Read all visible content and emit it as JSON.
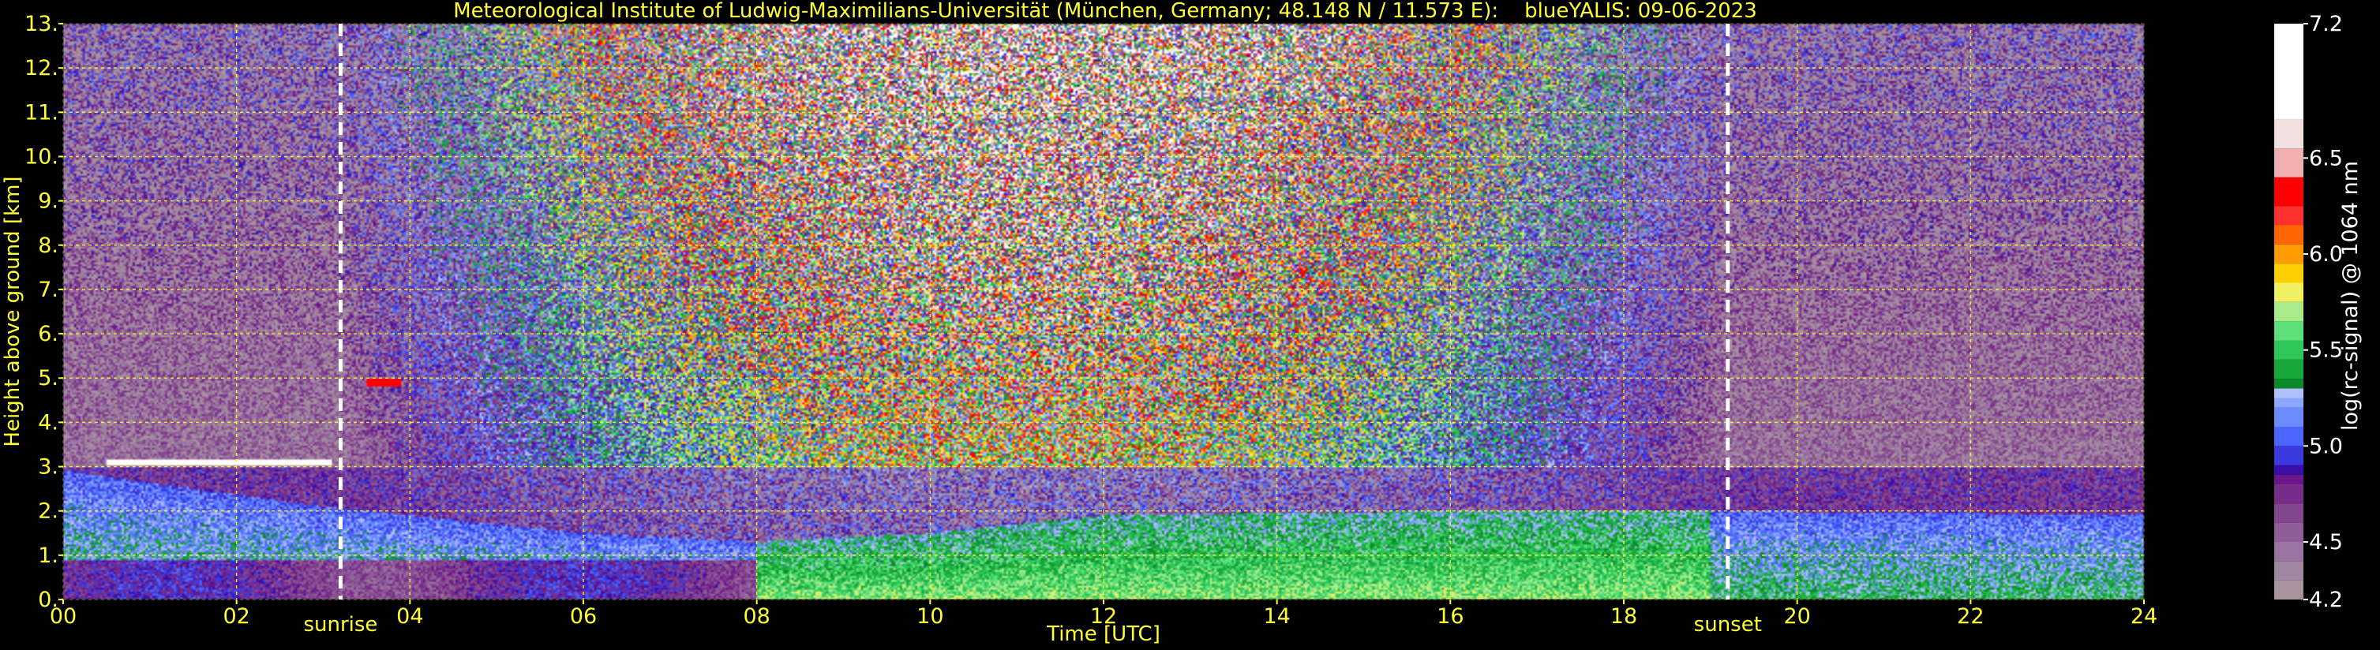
{
  "chart_data": {
    "type": "heatmap",
    "title": "Meteorological Institute of Ludwig-Maximilians-Universität (München, Germany; 48.148 N / 11.573 E):    blueYALIS: 09-06-2023",
    "xlabel": "Time [UTC]",
    "ylabel": "Height above ground [km]",
    "xlim": [
      0,
      24
    ],
    "ylim": [
      0,
      13
    ],
    "x_ticks": [
      "00",
      "02",
      "04",
      "06",
      "08",
      "10",
      "12",
      "14",
      "16",
      "18",
      "20",
      "22",
      "24"
    ],
    "x_tick_values": [
      0,
      2,
      4,
      6,
      8,
      10,
      12,
      14,
      16,
      18,
      20,
      22,
      24
    ],
    "y_ticks": [
      "0.",
      "1.",
      "2.",
      "3.",
      "4.",
      "5.",
      "6.",
      "7.",
      "8.",
      "9.",
      "10.",
      "11.",
      "12.",
      "13."
    ],
    "y_tick_values": [
      0,
      1,
      2,
      3,
      4,
      5,
      6,
      7,
      8,
      9,
      10,
      11,
      12,
      13
    ],
    "grid": true,
    "markers": [
      {
        "label": "sunrise",
        "x": 3.2
      },
      {
        "label": "sunset",
        "x": 19.2
      }
    ],
    "colorbar": {
      "label": "log(rc-signal) @ 1064 nm",
      "range": [
        4.2,
        7.2
      ],
      "tick_labels": [
        "4.2",
        "4.5",
        "5.0",
        "5.5",
        "6.0",
        "6.5",
        "7.2"
      ],
      "tick_values": [
        4.2,
        4.5,
        5.0,
        5.5,
        6.0,
        6.5,
        7.2
      ],
      "levels": [
        {
          "v": 4.2,
          "color": "#a8949e"
        },
        {
          "v": 4.3,
          "color": "#a085a1"
        },
        {
          "v": 4.4,
          "color": "#9a74a0"
        },
        {
          "v": 4.5,
          "color": "#8f5d97"
        },
        {
          "v": 4.6,
          "color": "#84468e"
        },
        {
          "v": 4.7,
          "color": "#782c8a"
        },
        {
          "v": 4.8,
          "color": "#6a158a"
        },
        {
          "v": 4.85,
          "color": "#3a0fa8"
        },
        {
          "v": 4.9,
          "color": "#3a3ae0"
        },
        {
          "v": 5.0,
          "color": "#4a66ff"
        },
        {
          "v": 5.1,
          "color": "#6b8cff"
        },
        {
          "v": 5.2,
          "color": "#8aa8ff"
        },
        {
          "v": 5.25,
          "color": "#b0c0ff"
        },
        {
          "v": 5.3,
          "color": "#0b8a2a"
        },
        {
          "v": 5.35,
          "color": "#18a83a"
        },
        {
          "v": 5.45,
          "color": "#2ec75a"
        },
        {
          "v": 5.55,
          "color": "#5de07a"
        },
        {
          "v": 5.65,
          "color": "#a8ec8a"
        },
        {
          "v": 5.75,
          "color": "#f0f060"
        },
        {
          "v": 5.85,
          "color": "#ffd000"
        },
        {
          "v": 5.95,
          "color": "#ff9a00"
        },
        {
          "v": 6.05,
          "color": "#ff6600"
        },
        {
          "v": 6.15,
          "color": "#ff3030"
        },
        {
          "v": 6.25,
          "color": "#ff0000"
        },
        {
          "v": 6.4,
          "color": "#f0b0b0"
        },
        {
          "v": 6.55,
          "color": "#f0e0e0"
        },
        {
          "v": 6.7,
          "color": "#ffffff"
        },
        {
          "v": 7.2,
          "color": "#ffffff"
        }
      ]
    },
    "features": {
      "boundary_layer_top_km": [
        {
          "t": 0,
          "h": 2.9
        },
        {
          "t": 3,
          "h": 2.1
        },
        {
          "t": 6,
          "h": 1.5
        },
        {
          "t": 8,
          "h": 1.3
        },
        {
          "t": 10,
          "h": 1.5
        },
        {
          "t": 12,
          "h": 1.9
        },
        {
          "t": 16,
          "h": 2.0
        },
        {
          "t": 19,
          "h": 2.0
        },
        {
          "t": 24,
          "h": 1.9
        }
      ],
      "residual_layer_top_km": 3.0,
      "morning_cloud": {
        "t_start": 0.5,
        "t_end": 3.1,
        "h": 3.1
      },
      "small_cloud": {
        "t": 3.7,
        "h": 4.9
      },
      "colors": {
        "background": "#000000",
        "text": "#ffff33",
        "grid": "#ffff33",
        "marker": "#ffffff"
      }
    }
  }
}
